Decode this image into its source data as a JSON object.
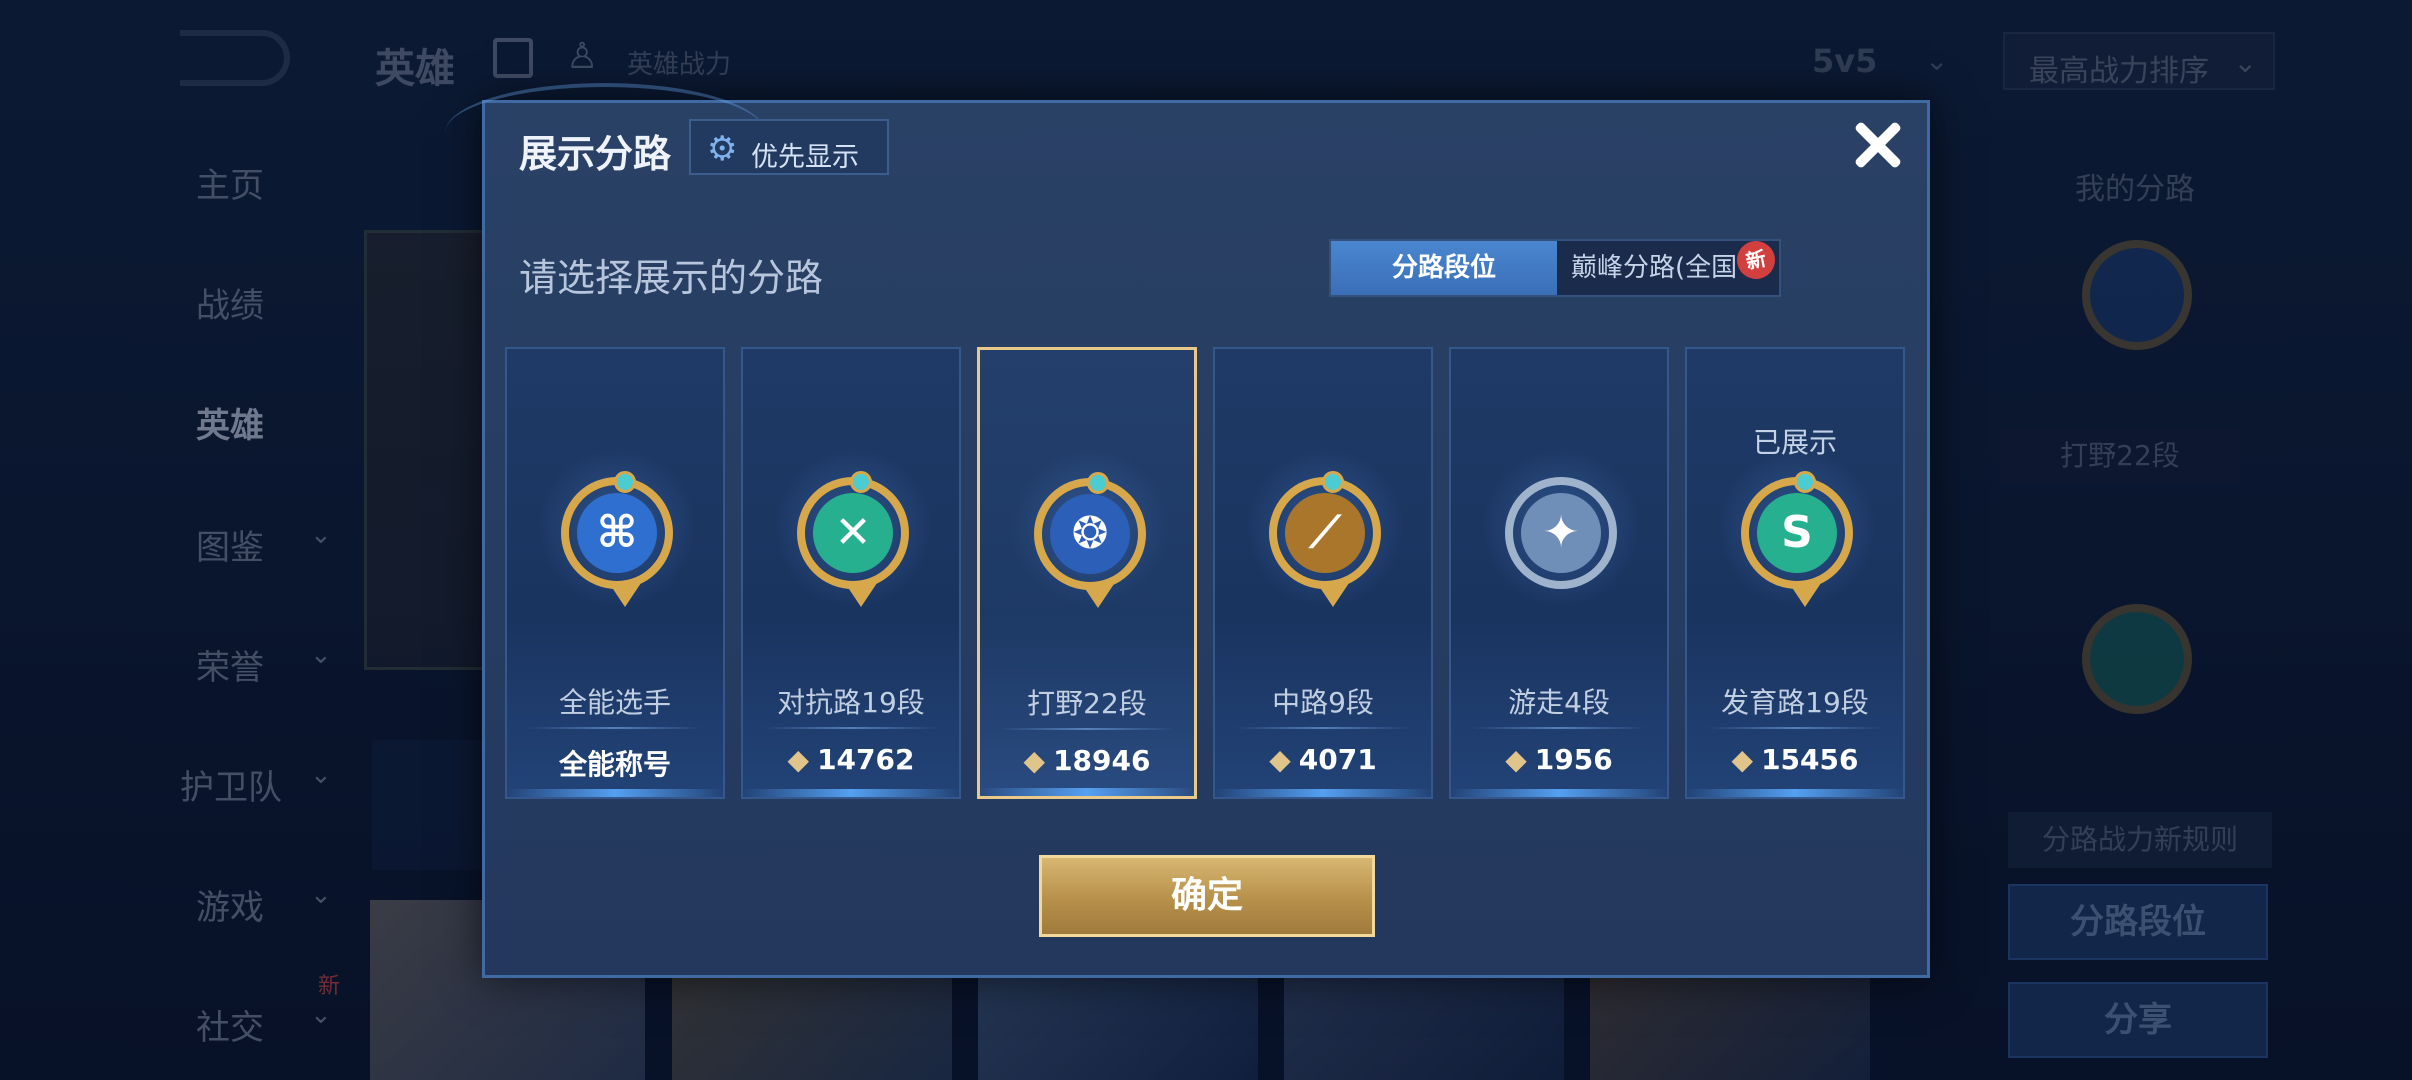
{
  "background": {
    "header": {
      "title": "英雄",
      "power_label": "英雄战力",
      "mode": "5v5",
      "sort": "最高战力排序"
    },
    "nav": [
      {
        "label": "主页"
      },
      {
        "label": "战绩"
      },
      {
        "label": "英雄"
      },
      {
        "label": "图鉴"
      },
      {
        "label": "荣誉"
      },
      {
        "label": "护卫队"
      },
      {
        "label": "游戏"
      },
      {
        "label": "社交"
      }
    ],
    "nav_new_badge": "新",
    "right_panel": {
      "title": "我的分路",
      "lane": "打野22段",
      "rule": "分路战力新规则",
      "lane_rank_button": "分路段位",
      "share_button": "分享"
    }
  },
  "modal": {
    "title": "展示分路",
    "priority_button": "优先显示",
    "prompt": "请选择展示的分路",
    "tabs": {
      "lane_rank": "分路段位",
      "peak_lane": "巅峰分路(全国",
      "new_badge": "新"
    },
    "cards": [
      {
        "lane": "全能选手",
        "score": "全能称号",
        "emblem_icon": "all-round-emblem-icon",
        "color": "#2f6fd0"
      },
      {
        "lane": "对抗路19段",
        "score": "14762",
        "emblem_icon": "clash-lane-emblem-icon",
        "color": "#27b08f"
      },
      {
        "lane": "打野22段",
        "score": "18946",
        "emblem_icon": "jungle-emblem-icon",
        "color": "#2b5fb8"
      },
      {
        "lane": "中路9段",
        "score": "4071",
        "emblem_icon": "mid-lane-emblem-icon",
        "color": "#a9762c"
      },
      {
        "lane": "游走4段",
        "score": "1956",
        "emblem_icon": "roam-emblem-icon",
        "color": "#6f8fb8"
      },
      {
        "lane": "发育路19段",
        "score": "15456",
        "emblem_icon": "farm-lane-emblem-icon",
        "color": "#27b08f",
        "shown_label": "已展示"
      }
    ],
    "power_icon": "power-icon",
    "confirm_button": "确定"
  }
}
